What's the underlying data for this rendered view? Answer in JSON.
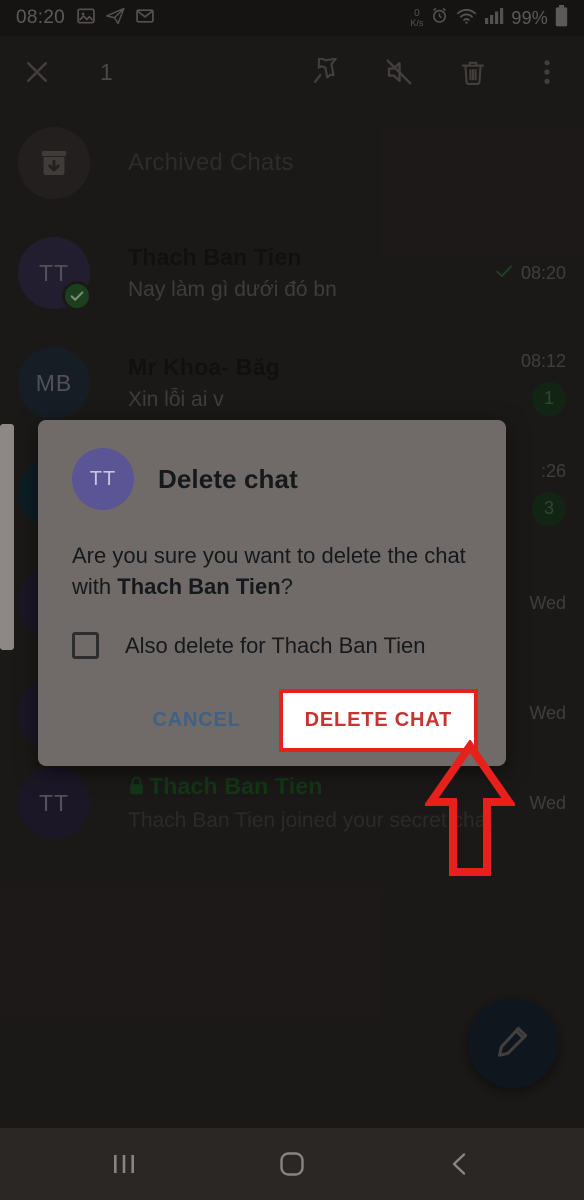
{
  "status_bar": {
    "time": "08:20",
    "left_icons": [
      "image-icon",
      "telegram-icon",
      "mail-icon"
    ],
    "net_speed_value": "0",
    "net_speed_unit": "K/s",
    "right_icons": [
      "alarm-icon",
      "wifi-icon",
      "signal-icon"
    ],
    "battery_percent": "99%"
  },
  "action_bar": {
    "close_label": "close-icon",
    "selected_count": "1",
    "actions": [
      {
        "name": "pin-icon",
        "label": "Pin"
      },
      {
        "name": "mute-icon",
        "label": "Mute"
      },
      {
        "name": "delete-icon",
        "label": "Delete"
      },
      {
        "name": "overflow-menu-icon",
        "label": "More options"
      }
    ]
  },
  "chat_list": {
    "archived": {
      "title": "Archived Chats"
    },
    "rows": [
      {
        "initials": "TT",
        "title": "Thach Ban Tien",
        "subtitle": "Nay làm gì dưới đó bn",
        "time": "08:20",
        "read_mark": "sent-check-icon",
        "badge": "",
        "selected": true,
        "secret": false,
        "avatar_color": "#3a3350"
      },
      {
        "initials": "MB",
        "title": "Mr Khoa- Băg",
        "subtitle": "Xin lỗi ai v",
        "time": "08:12",
        "read_mark": "",
        "badge": "1",
        "selected": false,
        "secret": false,
        "avatar_color": "#26313f"
      },
      {
        "initials": "",
        "title": "",
        "subtitle": "",
        "time": ":26",
        "read_mark": "",
        "badge": "3",
        "selected": false,
        "secret": false,
        "avatar_color": "#15333c"
      },
      {
        "initials": "",
        "title": "",
        "subtitle": "",
        "time": "Wed",
        "read_mark": "",
        "badge": "",
        "selected": false,
        "secret": false,
        "avatar_color": "#2f2740"
      },
      {
        "initials": "",
        "title": "",
        "subtitle": "",
        "time": "Wed",
        "read_mark": "",
        "badge": "",
        "selected": false,
        "secret": false,
        "avatar_color": "#2f2740"
      },
      {
        "initials": "TT",
        "title": "Thach Ban Tien",
        "subtitle": "Thach Ban Tien joined your secret chat",
        "time": "Wed",
        "read_mark": "",
        "badge": "",
        "selected": false,
        "secret": true,
        "avatar_color": "#2f2740"
      }
    ]
  },
  "fab": {
    "icon": "compose-pencil-icon"
  },
  "dialog": {
    "avatar_initials": "TT",
    "title": "Delete chat",
    "body_prefix": "Are you sure you want to delete the chat with ",
    "body_name": "Thach Ban Tien",
    "body_suffix": "?",
    "checkbox_label": "Also delete for Thach Ban Tien",
    "checkbox_checked": false,
    "cancel_label": "CANCEL",
    "confirm_label": "DELETE CHAT"
  },
  "annotation": {
    "highlight_color": "#e8201b",
    "arrow": "up-arrow-pointing-to-delete-chat"
  },
  "nav_bar": {
    "recents_label": "recents-icon",
    "home_label": "home-icon",
    "back_label": "back-icon"
  },
  "colors": {
    "accent_red": "#e8201b",
    "cancel_blue": "#3f6183",
    "unread_green": "#2d6b33",
    "secret_green": "#1f5c27",
    "dialog_bg": "#706b69",
    "app_bg": "#2e2a28"
  }
}
